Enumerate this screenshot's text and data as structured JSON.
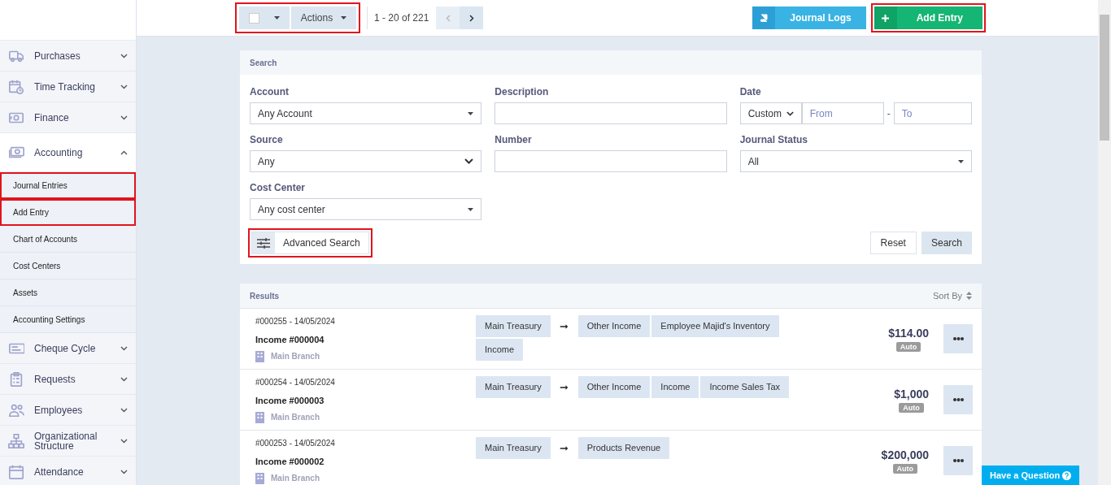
{
  "sidebar": {
    "items": [
      {
        "label": "Purchases",
        "expanded": false
      },
      {
        "label": "Time Tracking",
        "expanded": false
      },
      {
        "label": "Finance",
        "expanded": false
      },
      {
        "label": "Accounting",
        "expanded": true,
        "children": [
          {
            "label": "Journal Entries",
            "highlighted": true
          },
          {
            "label": "Add Entry",
            "highlighted": true
          },
          {
            "label": "Chart of Accounts",
            "highlighted": false
          },
          {
            "label": "Cost Centers",
            "highlighted": false
          },
          {
            "label": "Assets",
            "highlighted": false
          },
          {
            "label": "Accounting Settings",
            "highlighted": false
          }
        ]
      },
      {
        "label": "Cheque Cycle",
        "expanded": false
      },
      {
        "label": "Requests",
        "expanded": false
      },
      {
        "label": "Employees",
        "expanded": false
      },
      {
        "label": "Organizational Structure",
        "expanded": false
      },
      {
        "label": "Attendance",
        "expanded": false
      }
    ]
  },
  "toolbar": {
    "bulk_highlighted": true,
    "select_all": {
      "checked": false
    },
    "actions": "Actions",
    "pagination": "1 - 20 of 221",
    "prev_disabled": true,
    "next_disabled": false,
    "buttons": [
      {
        "label": "Journal Logs",
        "kind": "logs",
        "highlighted": false
      },
      {
        "label": "Add Entry",
        "kind": "add",
        "highlighted": true
      }
    ]
  },
  "search": {
    "title": "Search",
    "fields": [
      {
        "label": "Account",
        "kind": "select",
        "value": "Any Account"
      },
      {
        "label": "Description",
        "kind": "text"
      },
      {
        "label": "Date",
        "kind": "daterange",
        "value": "Custom",
        "from_placeholder": "From",
        "separator": "-",
        "to_placeholder": "To"
      },
      {
        "label": "Source",
        "kind": "native",
        "value": "Any"
      },
      {
        "label": "Number",
        "kind": "text"
      },
      {
        "label": "Journal Status",
        "kind": "select",
        "value": "All"
      },
      {
        "label": "Cost Center",
        "kind": "select",
        "value": "Any cost center"
      }
    ],
    "advanced": {
      "label": "Advanced Search",
      "highlighted": true
    },
    "reset": "Reset",
    "submit": "Search"
  },
  "results": {
    "title": "Results",
    "sort": "Sort By",
    "rows": [
      {
        "meta": "#000255 - 14/05/2024",
        "title": "Income #000004",
        "branch": "Main Branch",
        "from": [
          "Main Treasury"
        ],
        "arrow": "➞",
        "to": [
          "Other Income",
          "Employee Majid's Inventory",
          "Income"
        ],
        "amount": "$114.00",
        "badge": "Auto"
      },
      {
        "meta": "#000254 - 14/05/2024",
        "title": "Income #000003",
        "branch": "Main Branch",
        "from": [
          "Main Treasury"
        ],
        "arrow": "➞",
        "to": [
          "Other Income",
          "Income",
          "Income Sales Tax"
        ],
        "amount": "$1,000",
        "badge": "Auto"
      },
      {
        "meta": "#000253 - 14/05/2024",
        "title": "Income #000002",
        "branch": "Main Branch",
        "from": [
          "Main Treasury"
        ],
        "arrow": "➞",
        "to": [
          "Products Revenue"
        ],
        "amount": "$200,000",
        "badge": "Auto"
      }
    ]
  },
  "help_button": "Have a Question"
}
